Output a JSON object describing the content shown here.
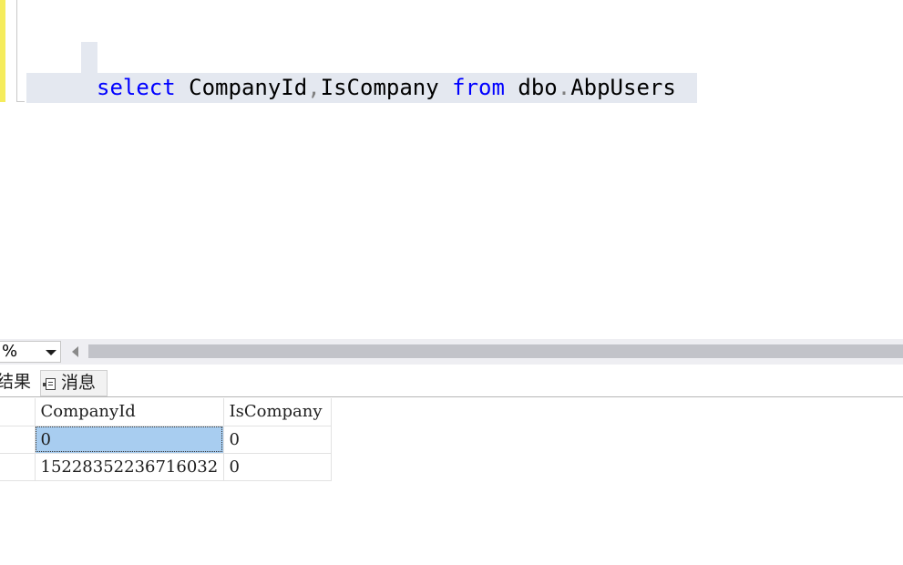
{
  "editor": {
    "code": {
      "kw_select": "select",
      "col1": " CompanyId",
      "comma": ",",
      "col2": "IsCompany ",
      "kw_from": "from",
      "schema": " dbo",
      "dot": ".",
      "table": "AbpUsers"
    }
  },
  "zoom": {
    "value": "%"
  },
  "tabs": {
    "results_label": "结果",
    "messages_label": "消息"
  },
  "grid": {
    "columns": [
      "CompanyId",
      "IsCompany"
    ],
    "rows": [
      [
        "0",
        "0"
      ],
      [
        "15228352236716032",
        "0"
      ]
    ]
  },
  "colors": {
    "keyword": "#0000ff",
    "selection": "#a8cdf0",
    "change_bar": "#f5ec5c"
  }
}
